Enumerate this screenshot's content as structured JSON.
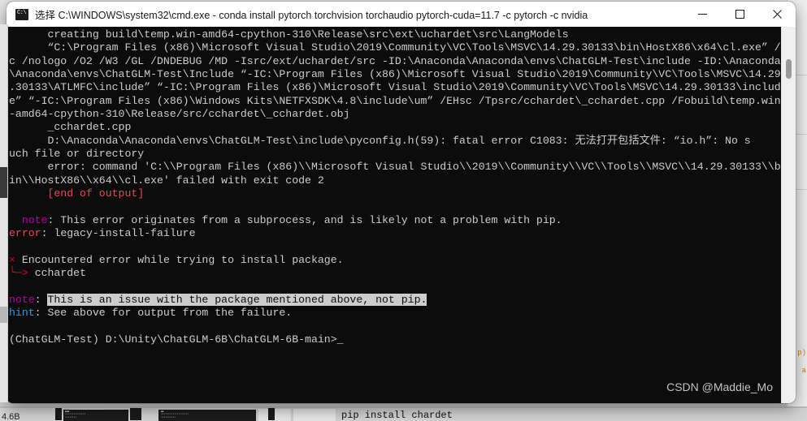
{
  "window": {
    "title": "选择 C:\\WINDOWS\\system32\\cmd.exe - conda  install pytorch torchvision torchaudio pytorch-cuda=11.7 -c pytorch -c nvidia",
    "icon_name": "cmd-icon",
    "icon_glyph": "C:\\",
    "minimize_label": "Minimize",
    "maximize_label": "Maximize",
    "close_label": "Close",
    "background_color": "#0c0c0c",
    "foreground_color": "#cccccc"
  },
  "terminal": {
    "lines": [
      [
        {
          "text": "      creating build\\temp.win-amd64-cpython-310\\Release\\src\\ext\\uchardet\\src\\LangModels",
          "cls": "c-white"
        }
      ],
      [
        {
          "text": "      “C:\\Program Files (x86)\\Microsoft Visual Studio\\2019\\Community\\VC\\Tools\\MSVC\\14.29.30133\\bin\\HostX86\\x64\\cl.exe” /",
          "cls": "c-white"
        }
      ],
      [
        {
          "text": "c /nologo /O2 /W3 /GL /DNDEBUG /MD -Isrc/ext/uchardet/src -ID:\\Anaconda\\Anaconda\\envs\\ChatGLM-Test\\include -ID:\\Anaconda",
          "cls": "c-white"
        }
      ],
      [
        {
          "text": "\\Anaconda\\envs\\ChatGLM-Test\\Include “-IC:\\Program Files (x86)\\Microsoft Visual Studio\\2019\\Community\\VC\\Tools\\MSVC\\14.29",
          "cls": "c-white"
        }
      ],
      [
        {
          "text": ".30133\\ATLMFC\\include” “-IC:\\Program Files (x86)\\Microsoft Visual Studio\\2019\\Community\\VC\\Tools\\MSVC\\14.29.30133\\includ",
          "cls": "c-white"
        }
      ],
      [
        {
          "text": "e” “-IC:\\Program Files (x86)\\Windows Kits\\NETFXSDK\\4.8\\include\\um” /EHsc /Tpsrc/cchardet\\_cchardet.cpp /Fobuild\\temp.win",
          "cls": "c-white"
        }
      ],
      [
        {
          "text": "-amd64-cpython-310\\Release/src/cchardet\\_cchardet.obj",
          "cls": "c-white"
        }
      ],
      [
        {
          "text": "      _cchardet.cpp",
          "cls": "c-white"
        }
      ],
      [
        {
          "text": "      D:\\Anaconda\\Anaconda\\envs\\ChatGLM-Test\\include\\pyconfig.h(59): fatal error C1083: 无法打开包括文件: “io.h”: No s",
          "cls": "c-white"
        }
      ],
      [
        {
          "text": "uch file or directory",
          "cls": "c-white"
        }
      ],
      [
        {
          "text": "      error: command 'C:\\\\Program Files (x86)\\\\Microsoft Visual Studio\\\\2019\\\\Community\\\\VC\\\\Tools\\\\MSVC\\\\14.29.30133\\\\b",
          "cls": "c-white"
        }
      ],
      [
        {
          "text": "in\\\\HostX86\\\\x64\\\\cl.exe' failed with exit code 2",
          "cls": "c-white"
        }
      ],
      [
        {
          "text": "      [end of output]",
          "cls": "c-bred"
        }
      ],
      [
        {
          "text": "",
          "cls": "c-white"
        }
      ],
      [
        {
          "text": "  note",
          "cls": "c-magb"
        },
        {
          "text": ": This error originates from a subprocess, and is likely not a problem with pip.",
          "cls": "c-white"
        }
      ],
      [
        {
          "text": "error",
          "cls": "c-bred"
        },
        {
          "text": ": legacy-install-failure",
          "cls": "c-white"
        }
      ],
      [
        {
          "text": "",
          "cls": "c-white"
        }
      ],
      [
        {
          "text": "×",
          "cls": "c-red"
        },
        {
          "text": " Encountered error while trying to install package.",
          "cls": "c-white"
        }
      ],
      [
        {
          "text": "╰─>",
          "cls": "c-red"
        },
        {
          "text": " cchardet",
          "cls": "c-white"
        }
      ],
      [
        {
          "text": "",
          "cls": "c-white"
        }
      ],
      [
        {
          "text": "note",
          "cls": "c-magb"
        },
        {
          "text": ": ",
          "cls": "c-white"
        },
        {
          "text": "This is an issue with the package mentioned above, not pip.",
          "cls": "sel"
        }
      ],
      [
        {
          "text": "hint",
          "cls": "c-cyan"
        },
        {
          "text": ": See above for output from the failure.",
          "cls": "c-white"
        }
      ],
      [
        {
          "text": "",
          "cls": "c-white"
        }
      ],
      [
        {
          "text": "(ChatGLM-Test) D:\\Unity\\ChatGLM-6B\\ChatGLM-6B-main>",
          "cls": "c-white"
        },
        {
          "text": "_",
          "cls": "c-white"
        }
      ]
    ]
  },
  "scrollbar": {
    "name": "terminal-vertical-scrollbar",
    "thumb_name": "terminal-scroll-thumb"
  },
  "watermark": {
    "text": "CSDN @Maddie_Mo"
  },
  "background": {
    "taskbar_label": "pip install chardet",
    "left_label": "4.6B",
    "right_snippets": [
      "p)",
      "a"
    ]
  }
}
